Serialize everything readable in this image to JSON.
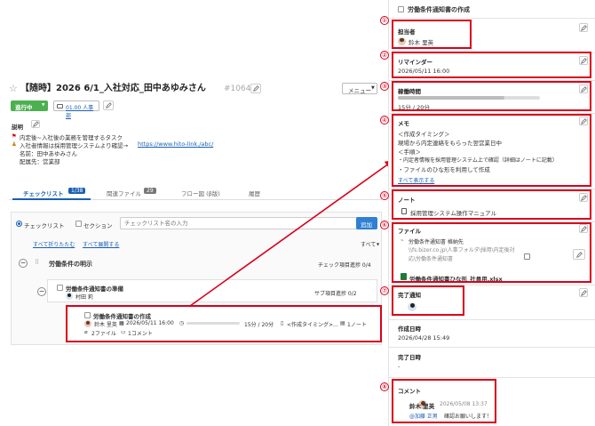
{
  "task": {
    "title": "【随時】2026 6/1_入社対応_田中あゆみさん",
    "id": "#10642",
    "menu_label": "メニュー",
    "status": "進行中",
    "dept": "01.00 人事部"
  },
  "description": {
    "label": "説明",
    "line1": "内定後~入社後の業務を管理するタスク",
    "line2_prefix": "入社者情報は採用管理システムより確認→",
    "line2_link": "https://www.hito-link./abc/",
    "line3": "名前：田中あゆみさん",
    "line4": "配属先：営業部"
  },
  "tabs": [
    {
      "label": "チェックリスト",
      "count": "1/38"
    },
    {
      "label": "関連ファイル",
      "count": "29"
    },
    {
      "label": "フロー図 (β版)"
    },
    {
      "label": "履歴"
    }
  ],
  "checklist": {
    "radio_checklist": "チェックリスト",
    "radio_section": "セクション",
    "input_placeholder": "チェックリスト名の入力",
    "add_button": "追加",
    "collapse_all": "すべて折りたたむ",
    "expand_all": "すべて展開する",
    "filter": "すべて",
    "section": {
      "title": "労働条件の明示",
      "progress": "チェック項目進捗 0/4"
    },
    "subitem": {
      "title": "労働条件通知書の準備",
      "assignee": "村田 莉",
      "progress": "サブ項目進捗 0/2"
    },
    "item": {
      "title": "労働条件通知書の作成",
      "assignee": "鈴木 里英",
      "reminder": "2026/05/11 16:00",
      "time": "15分 / 20分",
      "memo": "<作成タイミング>...",
      "notes": "1ノート",
      "files": "2ファイル",
      "comments": "1コメント"
    }
  },
  "detail": {
    "title": "労働条件通知書の作成",
    "assignee_label": "担当者",
    "assignee_name": "鈴木 里英",
    "reminder_label": "リマインダー",
    "reminder_value": "2026/05/11 16:00",
    "work_time_label": "稼働時間",
    "work_time_value": "15分 / 20分",
    "work_time_progress": 0.75,
    "memo_label": "メモ",
    "memo_lines": [
      "＜作成タイミング＞",
      "現場から内定連絡をもらった翌営業日中",
      "＜手順＞",
      "・内定者情報を採用管理システム上で確認（詳細はノートに記載）",
      "・ファイルのひな形を利用して作成"
    ],
    "memo_show_all": "すべて表示する",
    "note_label": "ノート",
    "note_item": "採用管理システム操作マニュアル",
    "file_label": "ファイル",
    "file1_name": "労働条件通知書 格納先",
    "file1_path": "\\\\fs.bizer.co.jp\\人事フォルダ\\採用\\内定後対応\\労働条件通知書",
    "file2_name": "労働条件通知書ひな形_社員用.xlsx",
    "done_notify_label": "完了通知",
    "created_label": "作成日時",
    "created_value": "2026/04/28 15:49",
    "completed_label": "完了日時",
    "completed_value": "-",
    "comment_label": "コメント",
    "comment_author": "鈴木 里英",
    "comment_date": "2026/05/08 13:37",
    "comment_mention": "@加藤 正男",
    "comment_text": "確認お願いします！"
  },
  "annotations": [
    "①",
    "②",
    "③",
    "④",
    "⑤",
    "⑥",
    "⑦",
    "⑧"
  ],
  "colors": {
    "status": "#4caf50",
    "link": "#1a5fb4",
    "accent_tab": "#1a5fb4",
    "annotation": "#d9001b",
    "add_button": "#2f7fd4"
  }
}
